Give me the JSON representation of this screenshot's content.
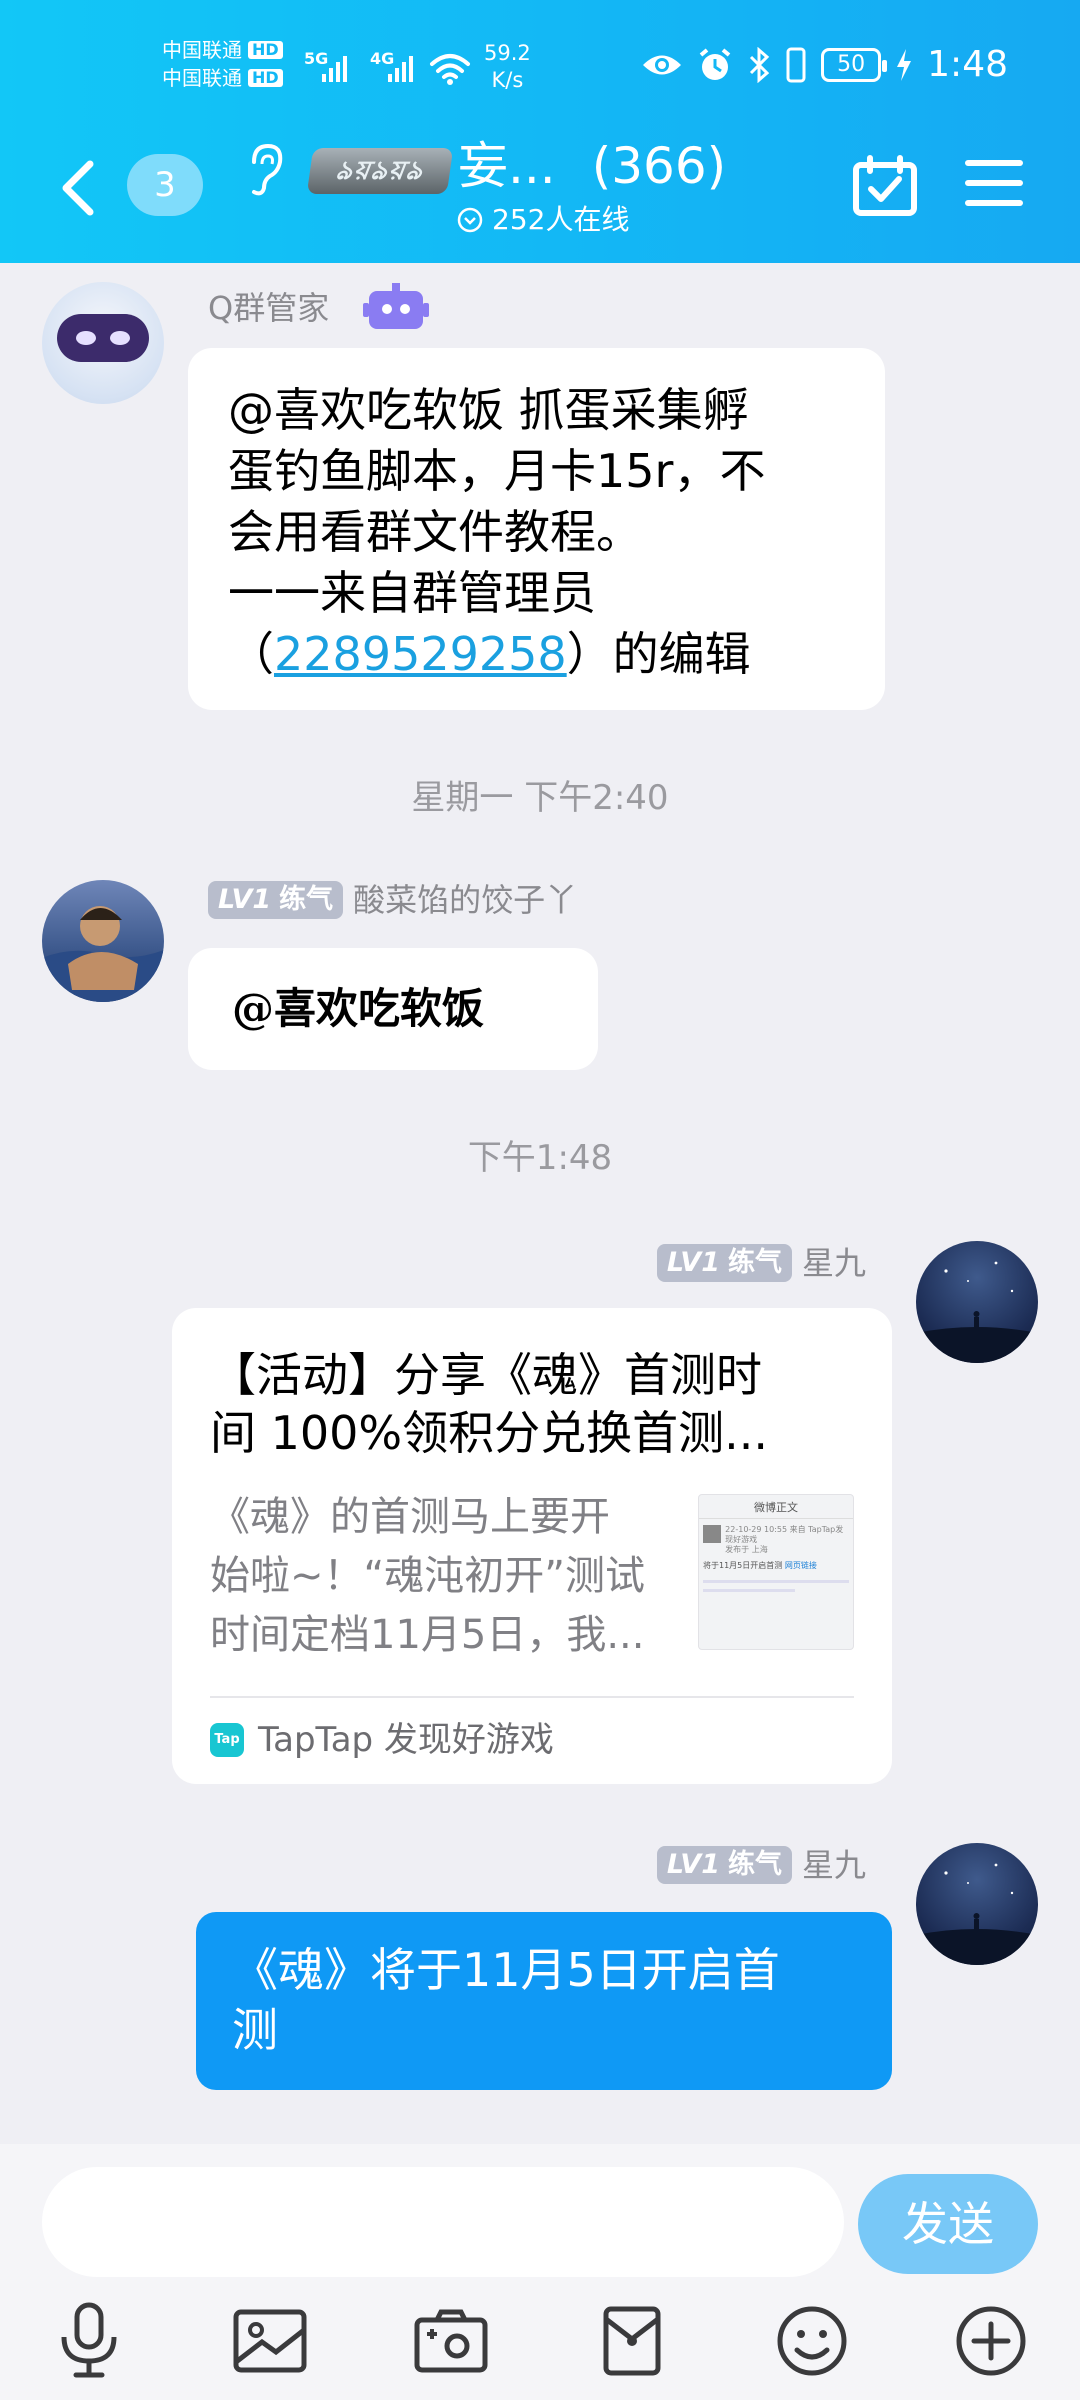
{
  "status_bar": {
    "carrier1": "中国联通",
    "carrier2": "中国联通",
    "hd": "HD",
    "net1": "5G",
    "net2": "4G",
    "speed_value": "59.2",
    "speed_unit": "K/s",
    "battery": "50",
    "time": "1:48"
  },
  "header": {
    "unread_badge": "3",
    "group_logo_text": "ঌয়ঌয়ঌ",
    "group_name": "妄...",
    "member_count": "(366)",
    "online_text": "252人在线"
  },
  "messages": [
    {
      "sender": "Q群管家",
      "text_line1": "@喜欢吃软饭 抓蛋采集孵",
      "text_line2": "蛋钓鱼脚本，月卡15r，不",
      "text_line3": "会用看群文件教程。",
      "text_line4": "一一来自群管理员",
      "text_line5_prefix": "（",
      "link": "2289529258",
      "text_line5_suffix": "）的编辑"
    },
    {
      "timestamp": "星期一 下午2:40"
    },
    {
      "level_tag": "LV1",
      "level_name": "练气",
      "sender": "酸菜馅的饺子丫",
      "text": "@喜欢吃软饭"
    },
    {
      "timestamp": "下午1:48"
    },
    {
      "level_tag": "LV1",
      "level_name": "练气",
      "sender": "星九",
      "card": {
        "title_line1": "【活动】分享《魂》首测时",
        "title_line2": "间 100%领积分兑换首测...",
        "desc_line1": "《魂》的首测马上要开",
        "desc_line2": "始啦~！“魂沌初开”测试",
        "desc_line3": "时间定档11月5日，我...",
        "thumb_title": "微博正文",
        "thumb_meta": "22-10-29 10:55 来自 TapTap发现好游戏",
        "thumb_sub": "发布于 上海",
        "thumb_text": "将于11月5日开启首测",
        "thumb_link": "网页链接",
        "source_logo": "Tap",
        "source": "TapTap 发现好游戏"
      }
    },
    {
      "level_tag": "LV1",
      "level_name": "练气",
      "sender": "星九",
      "text_line1": "《魂》将于11月5日开启首",
      "text_line2": "测"
    }
  ],
  "input_bar": {
    "placeholder": "",
    "send_label": "发送"
  },
  "colors": {
    "header": "#13b7f5",
    "blue_bubble": "#0f99f5",
    "send_button": "#78c8f7",
    "link": "#1aa0e0",
    "level_tag": "#b8bdcc"
  },
  "icons": [
    "back-arrow-icon",
    "ear-icon",
    "calendar-check-icon",
    "menu-icon",
    "robot-icon",
    "microphone-icon",
    "image-icon",
    "camera-icon",
    "red-packet-icon",
    "emoji-icon",
    "plus-icon"
  ]
}
